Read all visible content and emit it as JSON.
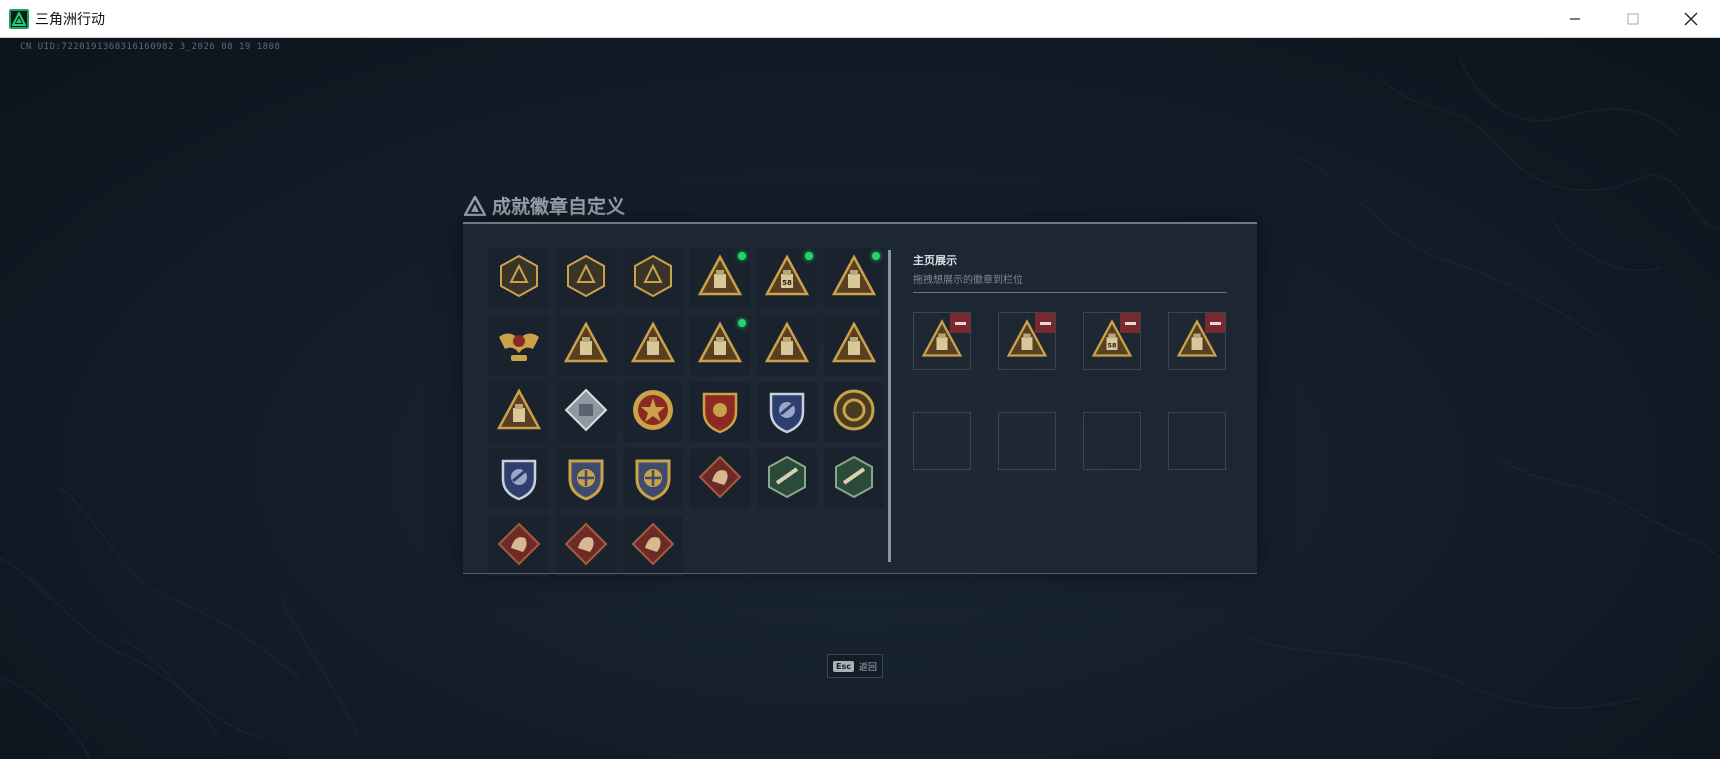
{
  "window": {
    "title": "三角洲行动",
    "controls": [
      "minimize",
      "maximize",
      "close"
    ]
  },
  "uid_text": "CN UID:7220191368316160982 3_2026 08 19 1808",
  "dialog": {
    "title": "成就徽章自定义",
    "panel_title": "主页展示",
    "panel_subtitle": "拖拽想展示的徽章到栏位"
  },
  "badges": [
    {
      "icon": "hex-delta-badge",
      "style": "hex-dark",
      "selected": false
    },
    {
      "icon": "helicopter-badge",
      "style": "hex-dark",
      "selected": false
    },
    {
      "icon": "diamond-emblem-badge",
      "style": "hex-dark",
      "selected": false
    },
    {
      "icon": "triangle-canister-badge",
      "style": "triangle",
      "selected": true
    },
    {
      "icon": "triangle-canister-58-badge",
      "style": "triangle",
      "selected": true
    },
    {
      "icon": "triangle-turret-badge",
      "style": "triangle",
      "selected": true
    },
    {
      "icon": "winged-eagle-badge",
      "style": "eagle",
      "selected": false
    },
    {
      "icon": "triangle-helmet-badge",
      "style": "triangle",
      "selected": false
    },
    {
      "icon": "triangle-number-1-badge",
      "style": "triangle",
      "selected": false
    },
    {
      "icon": "triangle-crate-badge",
      "style": "triangle",
      "selected": true
    },
    {
      "icon": "triangle-soldier-badge",
      "style": "triangle",
      "selected": false
    },
    {
      "icon": "triangle-squad-badge",
      "style": "triangle",
      "selected": false
    },
    {
      "icon": "triangle-tower-badge",
      "style": "triangle",
      "selected": false
    },
    {
      "icon": "silver-diamond-badge",
      "style": "diamond-silver",
      "selected": false
    },
    {
      "icon": "red-star-medal-badge",
      "style": "medal-red",
      "selected": false
    },
    {
      "icon": "red-shield-medal-badge",
      "style": "shield-red",
      "selected": false
    },
    {
      "icon": "blue-shield-medal-badge",
      "style": "shield-blue",
      "selected": false
    },
    {
      "icon": "gold-round-medal-badge",
      "style": "round-gold",
      "selected": false
    },
    {
      "icon": "blue-shield-wrench-badge",
      "style": "shield-blue",
      "selected": false
    },
    {
      "icon": "gold-shield-crosshair-badge",
      "style": "shield-gold",
      "selected": false
    },
    {
      "icon": "gold-shield-plane-badge",
      "style": "shield-gold",
      "selected": false
    },
    {
      "icon": "red-diamond-beast-badge",
      "style": "diamond-red",
      "selected": false
    },
    {
      "icon": "green-hex-eagle-badge",
      "style": "hex-green",
      "selected": false
    },
    {
      "icon": "green-hex-gun-badge",
      "style": "hex-green",
      "selected": false
    },
    {
      "icon": "red-diamond-dragon-badge",
      "style": "diamond-red",
      "selected": false
    },
    {
      "icon": "red-diamond-dragon-2-badge",
      "style": "diamond-red",
      "selected": false
    },
    {
      "icon": "red-diamond-fist-badge",
      "style": "diamond-red",
      "selected": false
    }
  ],
  "showcase_slots": [
    {
      "icon": "triangle-crate-badge",
      "filled": true
    },
    {
      "icon": "triangle-canister-badge",
      "filled": true
    },
    {
      "icon": "triangle-canister-58-badge",
      "filled": true
    },
    {
      "icon": "triangle-turret-badge",
      "filled": true
    },
    {
      "icon": "",
      "filled": false
    },
    {
      "icon": "",
      "filled": false
    },
    {
      "icon": "",
      "filled": false
    },
    {
      "icon": "",
      "filled": false
    }
  ],
  "esc": {
    "key": "Esc",
    "label": "返回"
  },
  "colors": {
    "accent_green": "#21d46b",
    "remove_red": "#7a2a2e",
    "gold": "#c9a24a",
    "background": "#141e2a"
  }
}
